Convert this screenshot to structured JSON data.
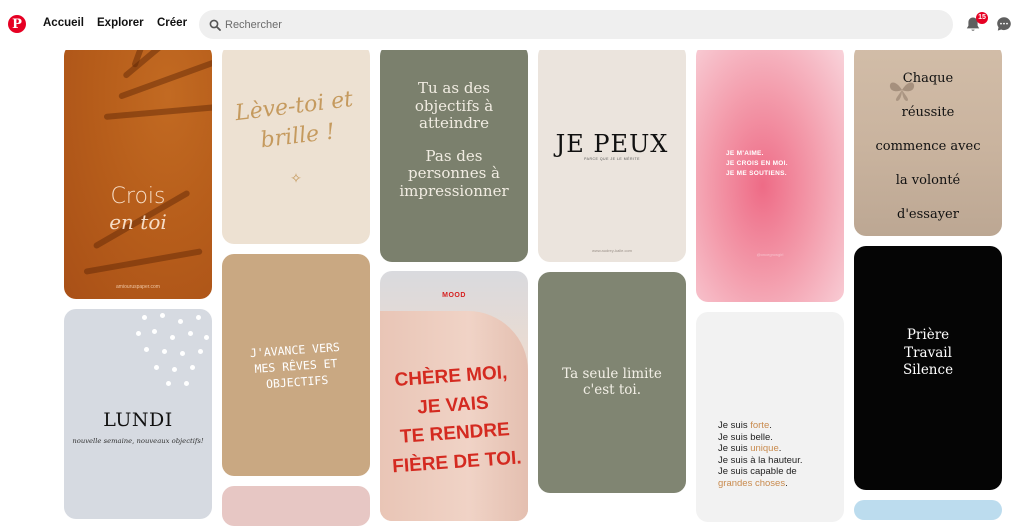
{
  "header": {
    "logo_letter": "P",
    "nav": [
      "Accueil",
      "Explorer",
      "Créer"
    ],
    "search_placeholder": "Rechercher",
    "notifications_count": "15"
  },
  "pins": {
    "crois": {
      "line1": "Crois",
      "line2": "en toi",
      "credit": "amiouruspaper.com"
    },
    "leve": {
      "line1": "Lève-toi et",
      "line2": "brille !",
      "deco": "✧"
    },
    "objectifs": {
      "line1": "Tu as des",
      "line2": "objectifs à",
      "line3": "atteindre",
      "line4": "Pas des",
      "line5": "personnes à",
      "line6": "impressionner"
    },
    "jepeux": {
      "title": "JE PEUX",
      "sub": "PARCE QUE JE LE MÉRITE",
      "credit": "www.audrey-kalle.com"
    },
    "jemaime": {
      "line1": "JE M'AIME.",
      "line2": "JE CROIS EN MOI.",
      "line3": "JE ME SOUTIENS.",
      "credit": "@oncegrowgirl"
    },
    "chaque": {
      "line1": "Chaque",
      "line2": "réussite",
      "line3": "commence avec",
      "line4": "la volonté",
      "line5": "d'essayer"
    },
    "lundi": {
      "title": "LUNDI",
      "sub": "nouvelle semaine, nouveaux objectifs!"
    },
    "avance": {
      "line1": "J'AVANCE VERS",
      "line2": "MES RÊVES ET",
      "line3": "OBJECTIFS"
    },
    "chere": {
      "tag": "MOOD",
      "line1": "CHÈRE MOI,",
      "line2": "JE VAIS",
      "line3": "TE RENDRE",
      "line4": "FIÈRE DE TOI."
    },
    "limite": {
      "line1": "Ta seule limite",
      "line2": "c'est toi."
    },
    "jesuis": {
      "l1a": "Je suis ",
      "l1b": "forte",
      "l1c": ".",
      "l2": "Je suis belle.",
      "l3a": "Je suis ",
      "l3b": "unique",
      "l3c": ".",
      "l4": "Je suis à la hauteur.",
      "l5": "Je suis capable de",
      "l6": "grandes choses",
      "l6c": "."
    },
    "priere": {
      "line1": "Prière",
      "line2": "Travail",
      "line3": "Silence"
    }
  },
  "colors": {
    "brand": "#e60023",
    "accent": "#c98b4e"
  }
}
